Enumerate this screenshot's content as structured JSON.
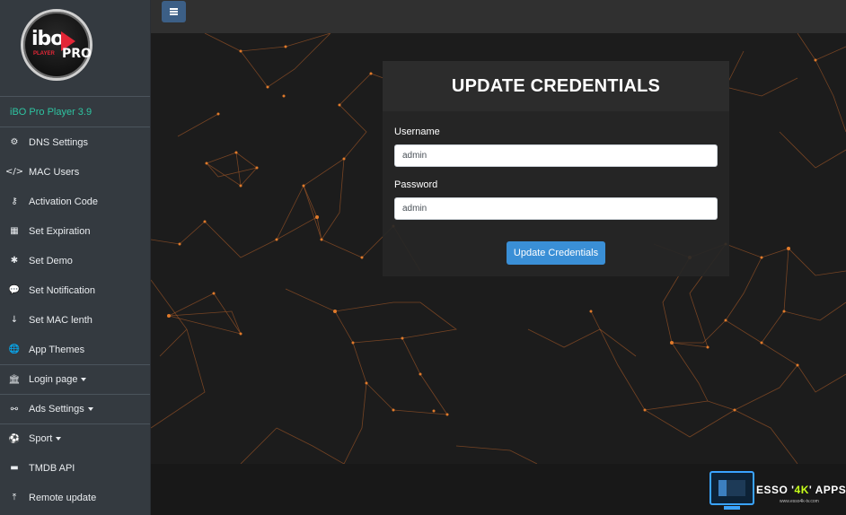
{
  "sidebar": {
    "version": "iBO Pro Player 3.9",
    "logo_text": {
      "brand": "ibo",
      "pro": "PRO",
      "player": "PLAYER"
    },
    "items": [
      {
        "label": "DNS Settings",
        "icon": "cogs-icon",
        "caret": false
      },
      {
        "label": "MAC Users",
        "icon": "code-icon",
        "caret": false
      },
      {
        "label": "Activation Code",
        "icon": "key-icon",
        "caret": false
      },
      {
        "label": "Set Expiration",
        "icon": "calendar-icon",
        "caret": false
      },
      {
        "label": "Set Demo",
        "icon": "asterisk-icon",
        "caret": false
      },
      {
        "label": "Set Notification",
        "icon": "comment-icon",
        "caret": false
      },
      {
        "label": "Set MAC lenth",
        "icon": "sort-numeric-icon",
        "caret": false
      },
      {
        "label": "App Themes",
        "icon": "globe-icon",
        "caret": false
      },
      {
        "label": "Login page",
        "icon": "bank-icon",
        "caret": true
      },
      {
        "label": "Ads Settings",
        "icon": "binoculars-icon",
        "caret": true
      },
      {
        "label": "Sport",
        "icon": "soccer-ball-icon",
        "caret": true
      },
      {
        "label": "TMDB API",
        "icon": "tv-icon",
        "caret": false
      },
      {
        "label": "Remote update",
        "icon": "upload-icon",
        "caret": false
      }
    ]
  },
  "form": {
    "title": "UPDATE CREDENTIALS",
    "username_label": "Username",
    "username_value": "admin",
    "password_label": "Password",
    "password_value": "admin",
    "submit_label": "Update Credentials"
  },
  "watermark": {
    "text_before": "ESSO '",
    "highlight": "4K",
    "text_after": "' APPS",
    "sub": "www.esso4k-tv.com"
  },
  "colors": {
    "sidebar_bg": "#343a40",
    "accent_green": "#2ec4a1",
    "button_blue": "#3a8fd6",
    "network_orange": "#e07a2a"
  }
}
